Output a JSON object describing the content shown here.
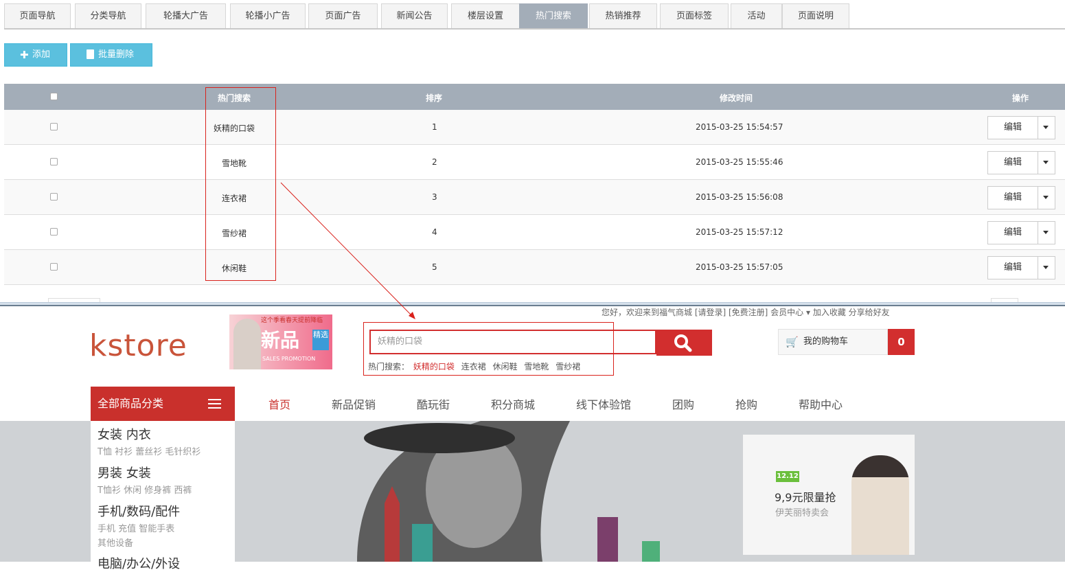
{
  "tabs": [
    "页面导航",
    "分类导航",
    "轮播大广告",
    "轮播小广告",
    "页面广告",
    "新闻公告",
    "楼层设置",
    "热门搜索",
    "热销推荐",
    "页面标签",
    "活动",
    "页面说明"
  ],
  "active_tab": "热门搜索",
  "toolbar": {
    "add_label": "添加",
    "batch_delete_label": "批量删除"
  },
  "table": {
    "headers": {
      "name": "热门搜索",
      "order": "排序",
      "modified": "修改时间",
      "actions": "操作"
    },
    "rows": [
      {
        "name": "妖精的口袋",
        "order": "1",
        "modified": "2015-03-25 15:54:57",
        "edit": "编辑"
      },
      {
        "name": "雪地靴",
        "order": "2",
        "modified": "2015-03-25 15:55:46",
        "edit": "编辑"
      },
      {
        "name": "连衣裙",
        "order": "3",
        "modified": "2015-03-25 15:56:08",
        "edit": "编辑"
      },
      {
        "name": "雪纱裙",
        "order": "4",
        "modified": "2015-03-25 15:57:12",
        "edit": "编辑"
      },
      {
        "name": "休闲鞋",
        "order": "5",
        "modified": "2015-03-25 15:57:05",
        "edit": "编辑"
      }
    ]
  },
  "store": {
    "top_links": "您好，欢迎来到福气商城  [请登录] [免费注册]  会员中心 ▾  加入收藏  分享给好友",
    "logo": "kstore",
    "promo": {
      "top": "这个季看春天提前降临",
      "big": "新品",
      "tag": "精选",
      "sub": "SALES PROMOTION"
    },
    "search_value": "妖精的口袋",
    "hot_label": "热门搜索：",
    "hot_terms": [
      "妖精的口袋",
      "连衣裙",
      "休闲鞋",
      "雪地靴",
      "雪纱裙"
    ],
    "cart_label": "我的购物车",
    "cart_count": "0",
    "all_categories": "全部商品分类",
    "nav": [
      "首页",
      "新品促销",
      "酷玩街",
      "积分商城",
      "线下体验馆",
      "团购",
      "抢购",
      "帮助中心"
    ],
    "categories": [
      {
        "main": "女装  内衣",
        "sub": "T恤  衬衫  蕾丝衫  毛针织衫"
      },
      {
        "main": "男装  女装",
        "sub": "T恤衫  休闲  修身裤  西裤"
      },
      {
        "main": "手机/数码/配件",
        "sub": "手机  充值  智能手表",
        "sub2": "其他设备"
      },
      {
        "main": "电脑/办公/外设",
        "sub": ""
      }
    ],
    "ad": {
      "badge": "12.12",
      "title": "9,9元限量抢",
      "subtitle": "伊芙丽特卖会"
    }
  },
  "colors": {
    "accent_red": "#d22e2e",
    "admin_header": "#a3adb8",
    "btn_blue": "#5bc0de",
    "annotation_red": "#d9211b"
  }
}
